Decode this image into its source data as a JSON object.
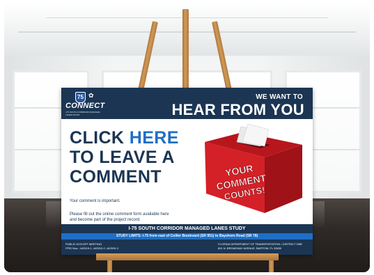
{
  "board": {
    "logo_number": "75",
    "logo_text": "CONNECT",
    "logo_sub": "I-75 SOUTH CORRIDOR MANAGED LANES STUDY",
    "header_line1": "WE WANT TO",
    "header_line2": "HEAR FROM YOU",
    "cta_click": "CLICK ",
    "cta_here": "HERE",
    "cta_line2": "TO LEAVE A",
    "cta_line3": "COMMENT",
    "important": "Your comment is important.",
    "instruction_line1": "Please fill out the online comment form available here",
    "instruction_line2": "and become part of the project record.",
    "box_text_1": "YOUR",
    "box_text_2": "COMMENT",
    "box_text_3": "COUNTS!",
    "study_title": "I-75 SOUTH CORRIDOR MANAGED LANES STUDY",
    "study_limits": "STUDY LIMITS: I-75 from east of Collier Boulevard (SR 951) to Bayshore Road (SR 78)",
    "footer_left_1": "PUBLIC KICKOFF MEETING",
    "footer_left_2": "FPID Nos.: 442519-1, 442519-2, 442519-3",
    "footer_right_1": "FLORIDA DEPARTMENT OF TRANSPORTATION • DISTRICT ONE",
    "footer_right_2": "801 N. BROADWAY AVENUE, BARTOW, FL 33830"
  },
  "colors": {
    "navy": "#1b3553",
    "blue": "#1f6fc4",
    "box_red": "#d42027",
    "wood": "#c28a4b"
  }
}
